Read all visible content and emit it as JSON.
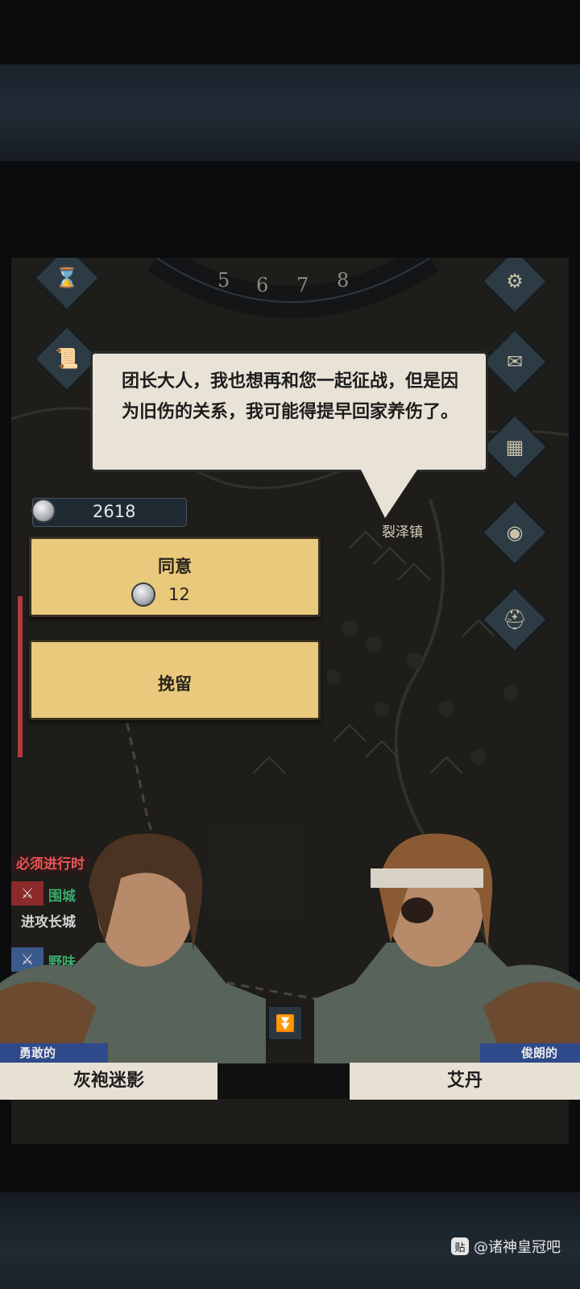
{
  "dialog": {
    "speech": "团长大人，我也想再和您一起征战，但是因为旧伤的关系，我可能得提早回家养伤了。"
  },
  "currency": {
    "amount": "2618"
  },
  "map": {
    "town_label": "裂泽镇",
    "dial_numbers": [
      "5",
      "6",
      "7",
      "8"
    ]
  },
  "choices": [
    {
      "label": "同意",
      "cost": "12"
    },
    {
      "label": "挽留"
    }
  ],
  "quests": [
    {
      "text": "必须进行时",
      "color": "#c0392b"
    },
    {
      "text": "围城",
      "color": "#2e8b57"
    },
    {
      "text": "进攻长城",
      "color": "#d0d0d0"
    },
    {
      "text": "野味",
      "color": "#2e8b57"
    }
  ],
  "left_character": {
    "epithet": "勇敢的",
    "name": "灰袍迷影"
  },
  "right_character": {
    "epithet": "俊朗的",
    "name": "艾丹"
  },
  "watermark": {
    "icon_text": "贴",
    "text": "@诸神皇冠吧"
  }
}
